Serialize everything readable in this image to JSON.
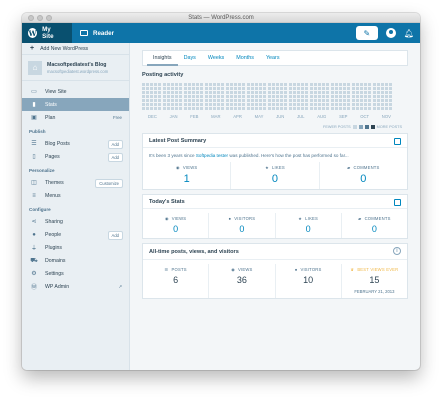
{
  "window": {
    "title": "Stats — WordPress.com"
  },
  "masterbar": {
    "my_site": "My Site",
    "reader": "Reader",
    "icons": [
      "wordpress-logo",
      "reader-icon",
      "write-icon",
      "avatar-icon",
      "bell-icon"
    ]
  },
  "sidebar": {
    "add_site": "Add New WordPress",
    "site_name": "Macsoftpediatest's Blog",
    "site_url": "macsoftpediatest.wordpress.com",
    "items_top": [
      {
        "label": "View Site",
        "icon": "computer-icon"
      },
      {
        "label": "Stats",
        "icon": "stats-icon"
      },
      {
        "label": "Plan",
        "icon": "plan-icon",
        "extra": "Free"
      }
    ],
    "publish_heading": "Publish",
    "publish_items": [
      {
        "label": "Blog Posts",
        "icon": "posts-icon",
        "badge": "Add"
      },
      {
        "label": "Pages",
        "icon": "pages-icon",
        "badge": "Add"
      }
    ],
    "personalize_heading": "Personalize",
    "personalize_items": [
      {
        "label": "Themes",
        "icon": "themes-icon",
        "badge": "Customize"
      },
      {
        "label": "Menus",
        "icon": "menus-icon"
      }
    ],
    "configure_heading": "Configure",
    "configure_items": [
      {
        "label": "Sharing",
        "icon": "share-icon"
      },
      {
        "label": "People",
        "icon": "people-icon",
        "badge": "Add"
      },
      {
        "label": "Plugins",
        "icon": "plugins-icon"
      },
      {
        "label": "Domains",
        "icon": "domains-icon"
      },
      {
        "label": "Settings",
        "icon": "settings-icon"
      },
      {
        "label": "WP Admin",
        "icon": "wp-admin-icon"
      }
    ]
  },
  "tabs": [
    "Insights",
    "Days",
    "Weeks",
    "Months",
    "Years"
  ],
  "activity": {
    "title": "Posting activity",
    "months": [
      "DEC",
      "JAN",
      "FEB",
      "MAR",
      "APR",
      "MAY",
      "JUN",
      "JUL",
      "AUG",
      "SEP",
      "OCT",
      "NOV"
    ],
    "legend_fewer": "FEWER POSTS",
    "legend_more": "MORE POSTS",
    "colors": [
      "#c8d7e1",
      "#87a6bc",
      "#4f748e",
      "#2e4453"
    ]
  },
  "latest": {
    "title": "Latest Post Summary",
    "text_pre": "It's been 3 years since",
    "text_link": "Softpedia tester",
    "text_post": "was published. Here's how the post has performed so far...",
    "stats": [
      {
        "label": "VIEWS",
        "value": "1",
        "icon": "eye-icon"
      },
      {
        "label": "LIKES",
        "value": "0",
        "icon": "star-icon"
      },
      {
        "label": "COMMENTS",
        "value": "0",
        "icon": "comment-icon"
      }
    ]
  },
  "today": {
    "title": "Today's Stats",
    "stats": [
      {
        "label": "VIEWS",
        "value": "0",
        "icon": "eye-icon"
      },
      {
        "label": "VISITORS",
        "value": "0",
        "icon": "person-icon"
      },
      {
        "label": "LIKES",
        "value": "0",
        "icon": "star-icon"
      },
      {
        "label": "COMMENTS",
        "value": "0",
        "icon": "comment-icon"
      }
    ]
  },
  "alltime": {
    "title": "All-time posts, views, and visitors",
    "stats": [
      {
        "label": "POSTS",
        "value": "6",
        "icon": "posts-icon"
      },
      {
        "label": "VIEWS",
        "value": "36",
        "icon": "eye-icon"
      },
      {
        "label": "VISITORS",
        "value": "10",
        "icon": "person-icon"
      },
      {
        "label": "BEST VIEWS EVER",
        "value": "15",
        "icon": "trophy-icon",
        "date": "FEBRUARY 21, 2013"
      }
    ]
  }
}
